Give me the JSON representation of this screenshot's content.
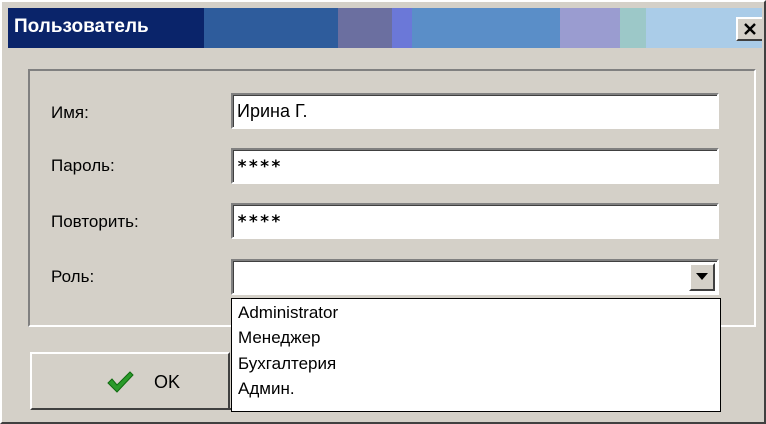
{
  "window": {
    "title": "Пользователь",
    "titlebar_colors": [
      "#0a246a",
      "#2e5c9c",
      "#3a6aa8",
      "#6b6fa0",
      "#6b78d8",
      "#5a8ec8",
      "#7ea7d8",
      "#9a9cd0",
      "#9cc8c8",
      "#aacce8",
      "#d8e8f4"
    ]
  },
  "form": {
    "name_label": "Имя:",
    "name_value": "Ирина Г.",
    "password_label": "Пароль:",
    "password_value": "****",
    "repeat_label": "Повторить:",
    "repeat_value": "****",
    "role_label": "Роль:",
    "role_value": ""
  },
  "role_options": [
    "Administrator",
    "Менеджер",
    "Бухгалтерия",
    "Админ."
  ],
  "buttons": {
    "ok_label": "OK"
  },
  "icons": {
    "close": "close-icon",
    "dropdown": "chevron-down-icon",
    "ok": "checkmark-icon"
  }
}
